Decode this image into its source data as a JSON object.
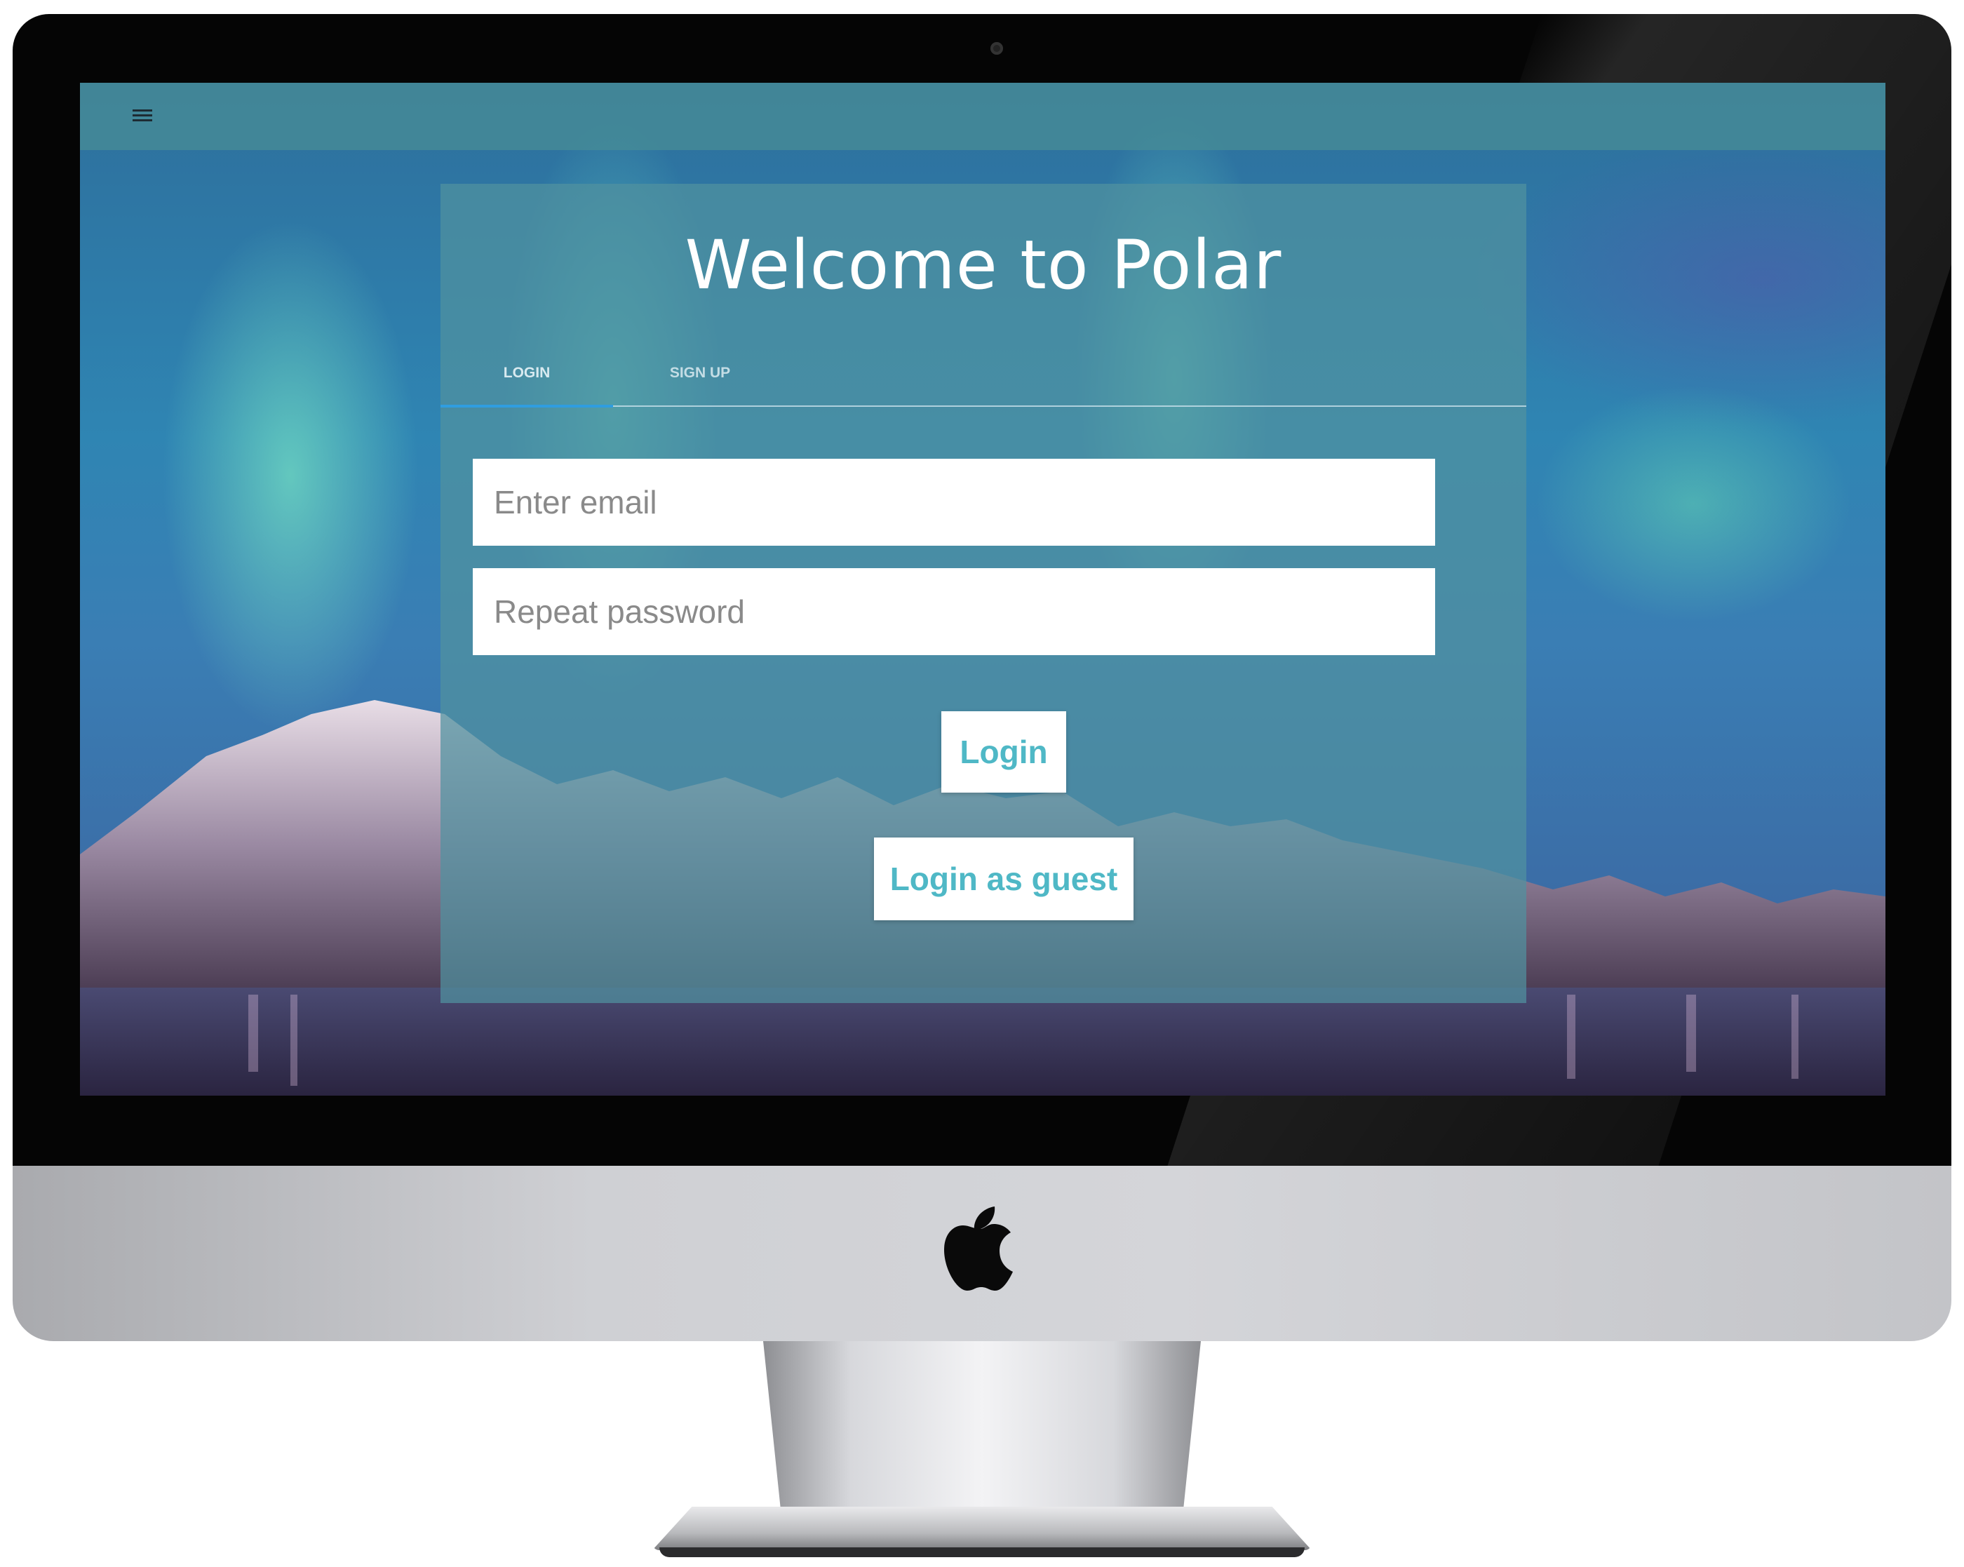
{
  "app": {
    "title": "Welcome to Polar"
  },
  "tabs": [
    {
      "label": "LOGIN",
      "active": true
    },
    {
      "label": "SIGN UP",
      "active": false
    }
  ],
  "form": {
    "email_placeholder": "Enter email",
    "email_value": "",
    "password_placeholder": "Repeat password",
    "password_value": ""
  },
  "buttons": {
    "login_label": "Login",
    "guest_label": "Login as guest"
  },
  "icons": {
    "menu": "hamburger-menu-icon",
    "device_logo": "apple-logo-icon"
  },
  "colors": {
    "accent_text": "#4fb8c6",
    "tab_indicator": "#2f9de0",
    "topbar": "#468c96",
    "card": "#5091a0"
  }
}
